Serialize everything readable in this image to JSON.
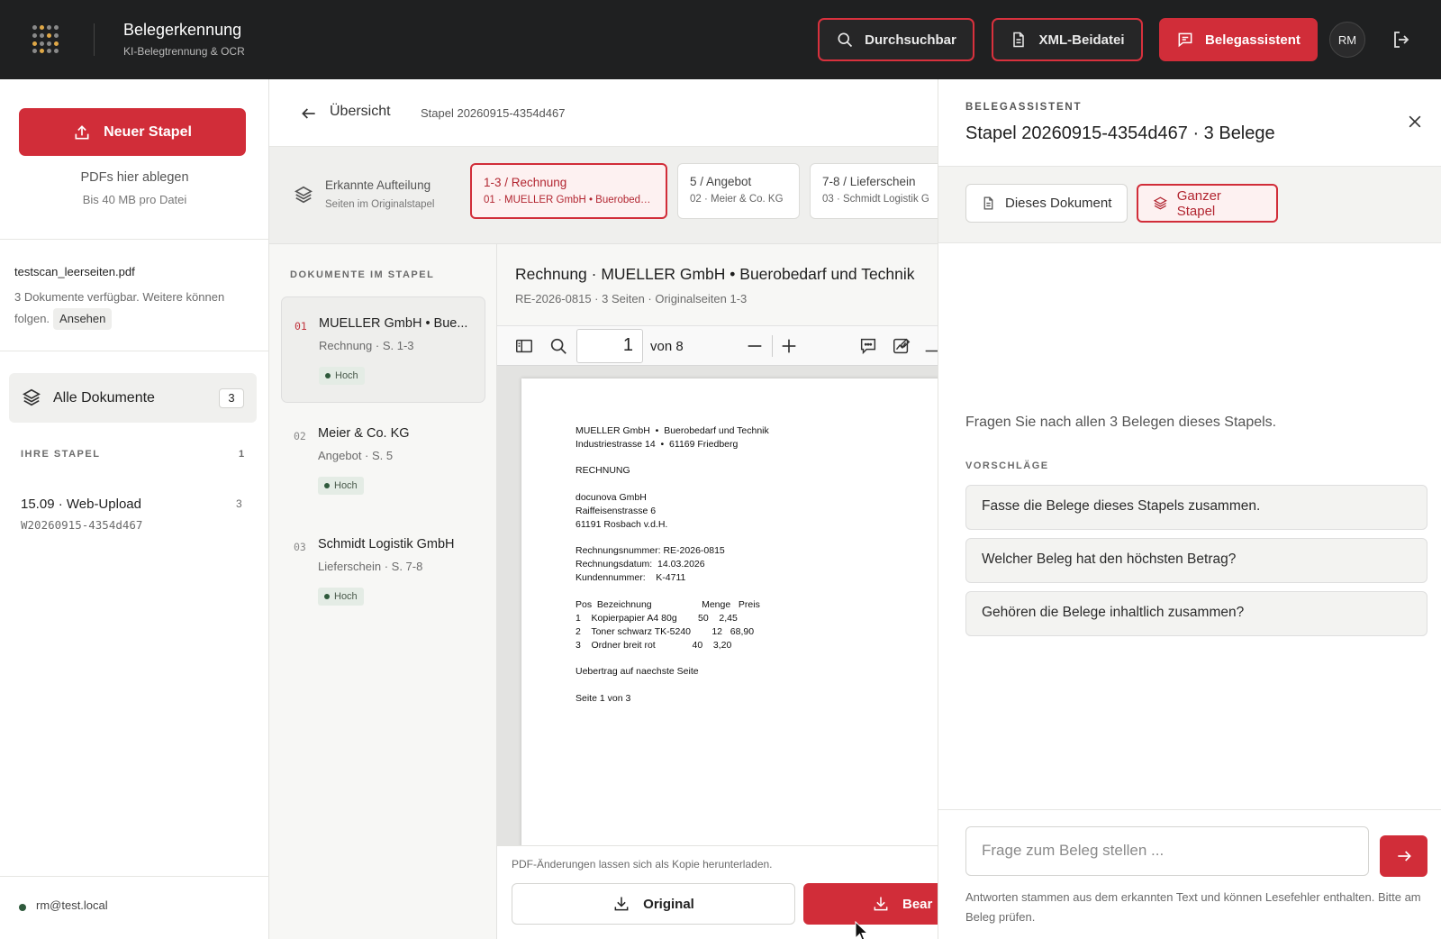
{
  "header": {
    "title": "Belegerkennung",
    "subtitle": "KI-Belegtrennung & OCR",
    "search_label": "Durchsuchbar",
    "xml_label": "XML-Beidatei",
    "assistant_label": "Belegassistent",
    "avatar_initials": "RM"
  },
  "sidebar": {
    "new_batch_label": "Neuer Stapel",
    "drop_title": "PDFs hier ablegen",
    "drop_limit": "Bis 40 MB pro Datei",
    "file_name": "testscan_leerseiten.pdf",
    "file_info": "3 Dokumente verfügbar. Weitere können folgen.",
    "view_label": "Ansehen",
    "all_docs_label": "Alle Dokumente",
    "all_docs_count": "3",
    "stacks_caption": "IHRE STAPEL",
    "stacks_count": "1",
    "stack_title": "15.09 · Web-Upload",
    "stack_id": "W20260915-4354d467",
    "stack_doc_count": "3",
    "user_email": "rm@test.local"
  },
  "breadcrumb": {
    "title": "Übersicht",
    "stack": "Stapel 20260915-4354d467"
  },
  "split": {
    "title": "Erkannte Aufteilung",
    "subtitle": "Seiten im Originalstapel",
    "chips": [
      {
        "range": "1-3 / Rechnung",
        "detail": "01 · MUELLER GmbH • Buerobed…"
      },
      {
        "range": "5 / Angebot",
        "detail": "02 · Meier & Co. KG"
      },
      {
        "range": "7-8 / Lieferschein",
        "detail": "03 · Schmidt Logistik G"
      }
    ]
  },
  "doclist": {
    "caption": "DOKUMENTE IM STAPEL",
    "items": [
      {
        "num": "01",
        "name": "MUELLER GmbH • Bue...",
        "meta": "Rechnung · S. 1-3",
        "badge": "Hoch"
      },
      {
        "num": "02",
        "name": "Meier & Co. KG",
        "meta": "Angebot · S. 5",
        "badge": "Hoch"
      },
      {
        "num": "03",
        "name": "Schmidt Logistik GmbH",
        "meta": "Lieferschein · S. 7-8",
        "badge": "Hoch"
      }
    ]
  },
  "viewer": {
    "title": "Rechnung · MUELLER GmbH • Buerobedarf und Technik",
    "meta": "RE-2026-0815 · 3 Seiten · Originalseiten 1-3",
    "page_value": "1",
    "page_of": "von 8",
    "pdf_lines": [
      "MUELLER GmbH  •  Buerobedarf und Technik",
      "Industriestrasse 14  •  61169 Friedberg",
      "RECHNUNG",
      "docunova GmbH",
      "Raiffeisenstrasse 6",
      "61191 Rosbach v.d.H.",
      "Rechnungsnummer: RE-2026-0815",
      "Rechnungsdatum:  14.03.2026",
      "Kundennummer:    K-4711",
      "Pos  Bezeichnung                   Menge   Preis",
      "1    Kopierpapier A4 80g        50    2,45",
      "2    Toner schwarz TK-5240        12   68,90",
      "3    Ordner breit rot              40    3,20",
      "Uebertrag auf naechste Seite",
      "Seite 1 von 3"
    ],
    "footer_note": "PDF-Änderungen lassen sich als Kopie herunterladen.",
    "original_label": "Original",
    "edited_label": "Bear"
  },
  "assistant": {
    "caption": "BELEGASSISTENT",
    "title": "Stapel 20260915-4354d467 · 3 Belege",
    "scope_doc": "Dieses Dokument",
    "scope_stack": "Ganzer Stapel",
    "intro": "Fragen Sie nach allen 3 Belegen dieses Stapels.",
    "suggestions_caption": "VORSCHLÄGE",
    "suggestions": [
      "Fasse die Belege dieses Stapels zusammen.",
      "Welcher Beleg hat den höchsten Betrag?",
      "Gehören die Belege inhaltlich zusammen?"
    ],
    "input_placeholder": "Frage zum Beleg stellen ...",
    "disclaimer": "Antworten stammen aus dem erkannten Text und können Lesefehler enthalten. Bitte am Beleg prüfen."
  },
  "colors": {
    "accent": "#d12d39",
    "topbar": "#1f2021",
    "badge_dot": "#2f5a3c"
  }
}
